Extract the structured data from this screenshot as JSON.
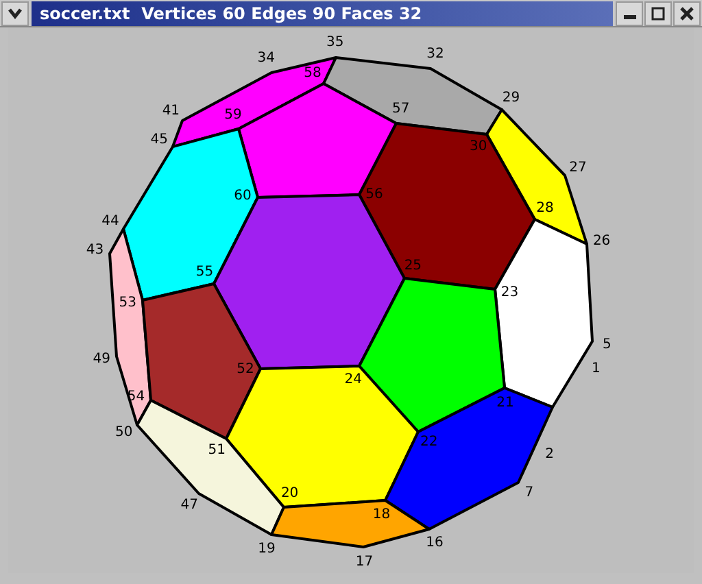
{
  "window": {
    "title": "soccer.txt  Vertices 60 Edges 90 Faces 32"
  },
  "faces": [
    {
      "color": "#ff00ff"
    },
    {
      "color": "#a9a9a9"
    },
    {
      "color": "#ff00ff"
    },
    {
      "color": "#ffff00"
    },
    {
      "color": "#8b0000"
    },
    {
      "color": "#00ffff"
    },
    {
      "color": "#a020f0"
    },
    {
      "color": "#ffc0cb"
    },
    {
      "color": "#ffffff"
    },
    {
      "color": "#00ff00"
    },
    {
      "color": "#a52a2a"
    },
    {
      "color": "#ffff00"
    },
    {
      "color": "#0000ff"
    },
    {
      "color": "#f5f5dc"
    },
    {
      "color": "#ffa500"
    }
  ],
  "vertex_labels": [
    "35",
    "32",
    "34",
    "58",
    "29",
    "41",
    "57",
    "59",
    "30",
    "45",
    "27",
    "56",
    "60",
    "28",
    "44",
    "26",
    "43",
    "25",
    "55",
    "23",
    "53",
    "5",
    "49",
    "1",
    "24",
    "52",
    "21",
    "54",
    "50",
    "22",
    "51",
    "2",
    "7",
    "47",
    "18",
    "20",
    "16",
    "19",
    "17"
  ]
}
